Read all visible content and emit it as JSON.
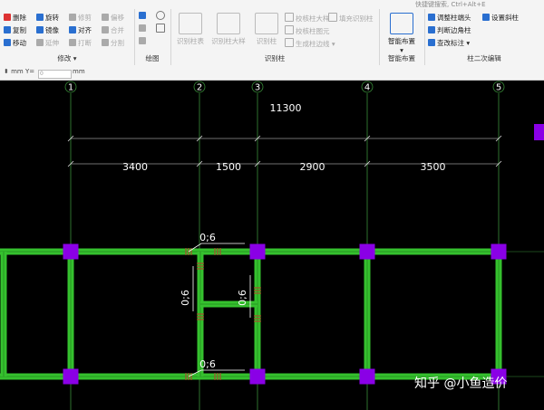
{
  "search": {
    "placeholder": "快捷键搜索, Ctrl+Alt+E"
  },
  "groups": {
    "modify": {
      "label": "修改",
      "items": [
        {
          "label": "删除",
          "enabled": true,
          "icon": "delete-icon",
          "color": "#d33"
        },
        {
          "label": "旋转",
          "enabled": true,
          "icon": "rotate-icon",
          "color": "#2a6fd0"
        },
        {
          "label": "修剪",
          "enabled": false,
          "icon": "trim-icon",
          "color": "#aaa"
        },
        {
          "label": "偏移",
          "enabled": false,
          "icon": "offset-icon",
          "color": "#aaa"
        },
        {
          "label": "复制",
          "enabled": true,
          "icon": "copy-icon",
          "color": "#2a6fd0"
        },
        {
          "label": "镜像",
          "enabled": true,
          "icon": "mirror-icon",
          "color": "#2a6fd0"
        },
        {
          "label": "对齐",
          "enabled": true,
          "icon": "align-icon",
          "color": "#2a6fd0"
        },
        {
          "label": "合并",
          "enabled": false,
          "icon": "merge-icon",
          "color": "#aaa"
        },
        {
          "label": "移动",
          "enabled": true,
          "icon": "move-icon",
          "color": "#2a6fd0"
        },
        {
          "label": "延伸",
          "enabled": false,
          "icon": "extend-icon",
          "color": "#aaa"
        },
        {
          "label": "打断",
          "enabled": false,
          "icon": "break-icon",
          "color": "#aaa"
        },
        {
          "label": "分割",
          "enabled": false,
          "icon": "split-icon",
          "color": "#aaa"
        }
      ]
    },
    "draw": {
      "label": "绘图"
    },
    "identify": {
      "label": "识别柱",
      "big": [
        "识别柱表",
        "识别柱大样",
        "识别柱"
      ],
      "small": [
        "校核柱大样",
        "填充识别柱",
        "校核柱图元",
        "生成柱边线"
      ]
    },
    "smart": {
      "label": "智能布置",
      "button": "智能布置"
    },
    "edit2": {
      "label": "柱二次编辑",
      "items": [
        "调整柱端头",
        "设置斜柱",
        "判断边角柱",
        "查改标注"
      ]
    }
  },
  "toolbar2": {
    "x_label": "mm Y=",
    "x_value": "0",
    "y_unit": "mm"
  },
  "canvas": {
    "axes": [
      "1",
      "2",
      "3",
      "4",
      "5"
    ],
    "total_dim": "11300",
    "spans": [
      "3400",
      "1500",
      "2900",
      "3500"
    ],
    "wall_labels": [
      "0;6",
      "0;6",
      "0;6",
      "0;6"
    ]
  },
  "colors": {
    "wall": "#35c12e",
    "column": "#8a00e6",
    "axis": "#3a8f3a",
    "background": "#000000"
  },
  "watermark": "知乎 @小鱼造价"
}
